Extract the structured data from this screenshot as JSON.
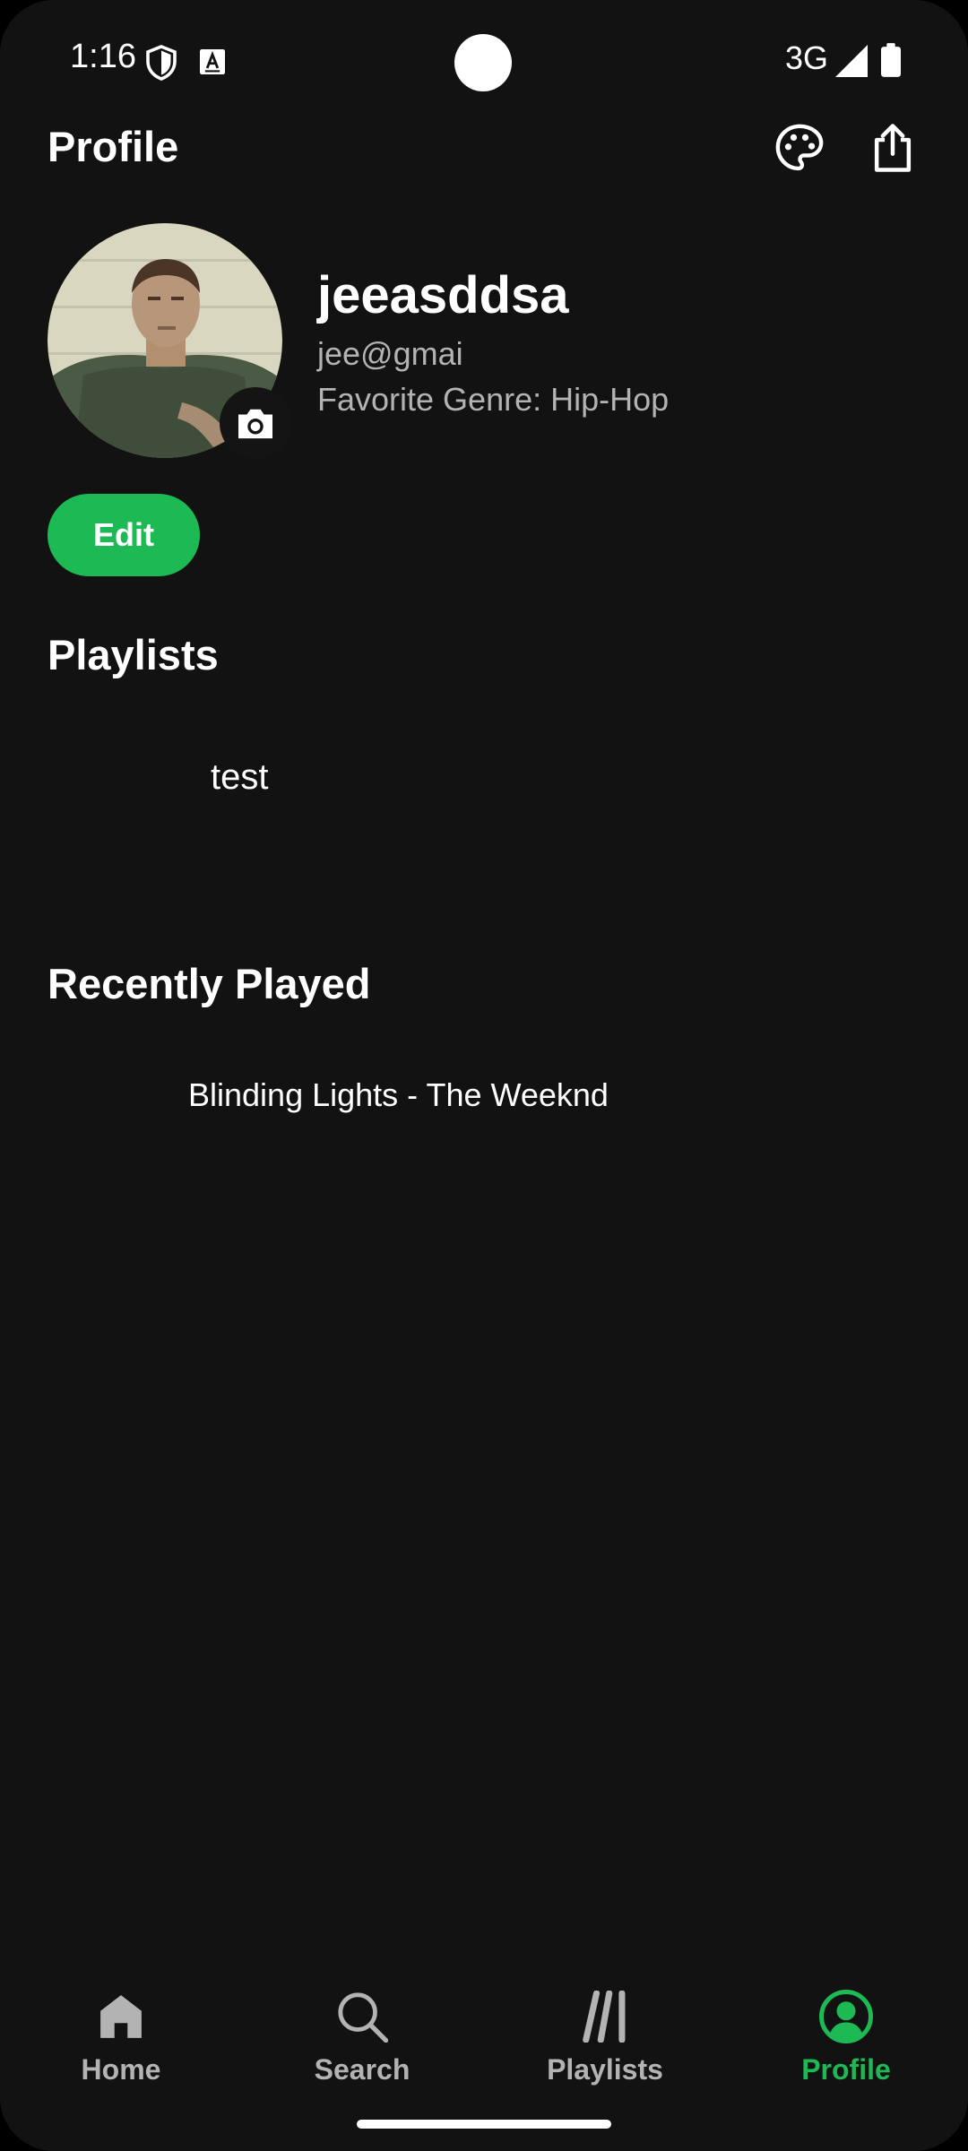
{
  "status_bar": {
    "time": "1:16",
    "network": "3G"
  },
  "header": {
    "title": "Profile",
    "icons": [
      "palette-icon",
      "share-icon"
    ]
  },
  "profile": {
    "name": "jeeasddsa",
    "email": "jee@gmai",
    "genre_label": "Favorite Genre: ",
    "genre_value": "Hip-Hop",
    "edit_label": "Edit"
  },
  "sections": {
    "playlists_title": "Playlists",
    "playlists": [
      {
        "name": "test"
      }
    ],
    "recent_title": "Recently Played",
    "recent": [
      {
        "title": "Blinding Lights - The Weeknd"
      }
    ]
  },
  "bottom_nav": {
    "items": [
      {
        "label": "Home",
        "icon": "home-icon",
        "active": false
      },
      {
        "label": "Search",
        "icon": "search-icon",
        "active": false
      },
      {
        "label": "Playlists",
        "icon": "library-icon",
        "active": false
      },
      {
        "label": "Profile",
        "icon": "profile-icon",
        "active": true
      }
    ]
  },
  "colors": {
    "background": "#121212",
    "accent": "#1db954",
    "text_primary": "#ffffff",
    "text_secondary": "#b3b3b3"
  }
}
